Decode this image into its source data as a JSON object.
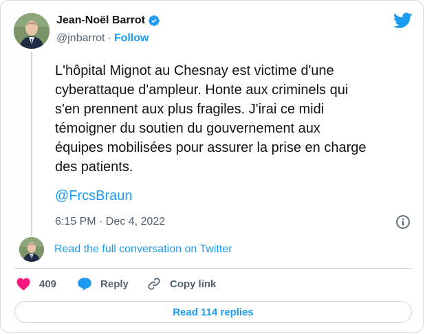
{
  "author": {
    "name": "Jean-Noël Barrot",
    "handle": "@jnbarrot",
    "separator": "·",
    "follow_label": "Follow"
  },
  "tweet": {
    "text": "L'hôpital Mignot au Chesnay est victime d'une\ncyberattaque d'ampleur. Honte aux criminels qui\ns'en prennent aux plus fragiles. J'irai ce midi\ntémoigner du soutien du gouvernement aux\néquipes mobilisées pour assurer la prise en charge\ndes patients.",
    "mention": "@FrcsBraun",
    "timestamp": "6:15 PM · Dec 4, 2022"
  },
  "conversation_link": "Read the full conversation on Twitter",
  "actions": {
    "like_count": "409",
    "reply_label": "Reply",
    "copy_link_label": "Copy link"
  },
  "read_replies_label": "Read 114 replies",
  "colors": {
    "accent": "#1d9bf0",
    "like": "#f91880",
    "text": "#0f1419",
    "secondary": "#536471",
    "border": "#cfd9de"
  },
  "icons": [
    "verified-badge-icon",
    "twitter-bird-icon",
    "info-icon",
    "heart-icon",
    "reply-bubble-icon",
    "link-icon"
  ]
}
